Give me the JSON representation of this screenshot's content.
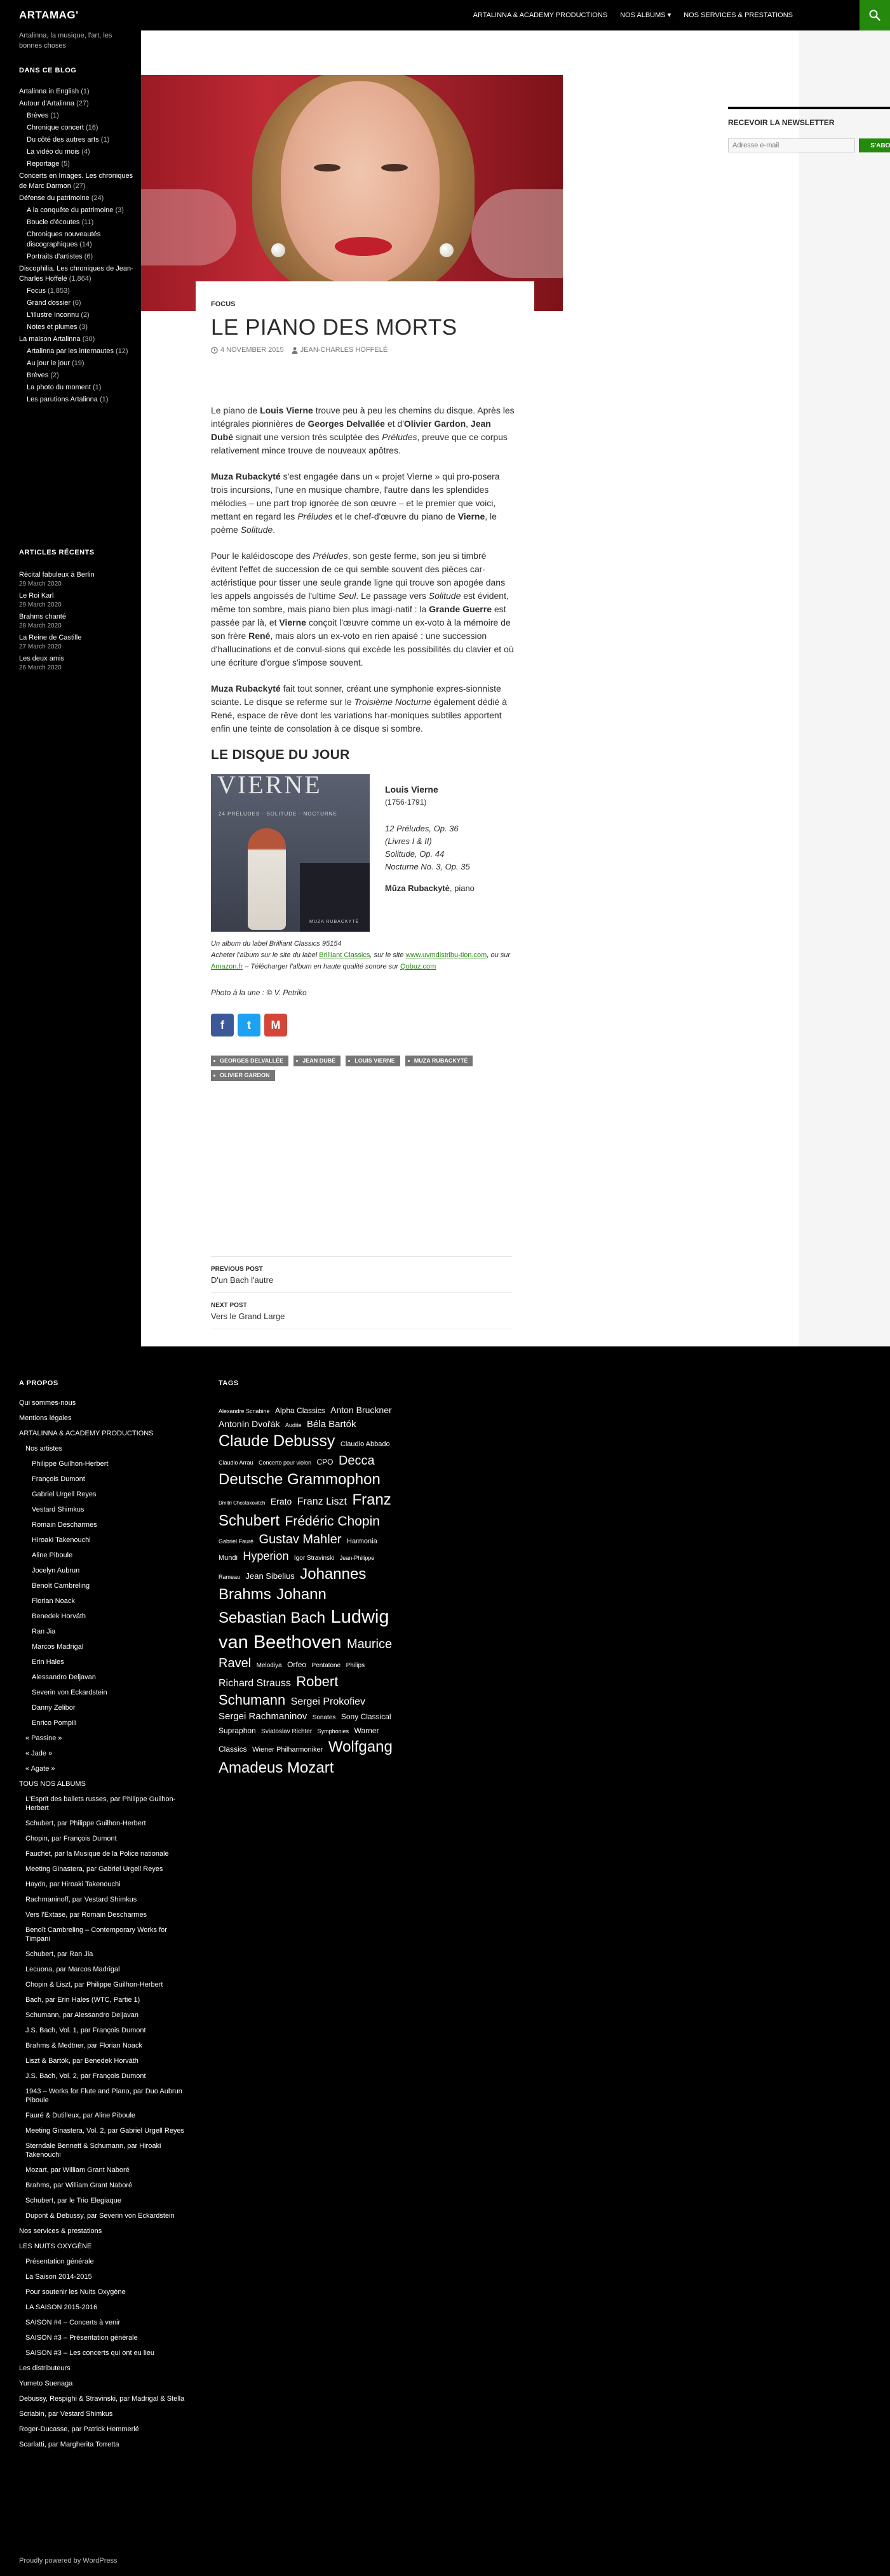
{
  "header": {
    "brand": "ARTAMAG'",
    "nav": [
      "ARTALINNA & ACADEMY PRODUCTIONS",
      "NOS ALBUMS",
      "NOS SERVICES & PRESTATIONS"
    ]
  },
  "left_sidebar": {
    "tagline": "Artalinna, la musique, l'art, les bonnes choses",
    "blog_title": "DANS CE BLOG",
    "categories": [
      {
        "label": "Artalinna in English",
        "count": "(1)",
        "sub": false
      },
      {
        "label": "Autour d'Artalinna",
        "count": "(27)",
        "sub": false
      },
      {
        "label": "Brèves",
        "count": "(1)",
        "sub": true
      },
      {
        "label": "Chronique concert",
        "count": "(16)",
        "sub": true
      },
      {
        "label": "Du côté des autres arts",
        "count": "(1)",
        "sub": true
      },
      {
        "label": "La vidéo du mois",
        "count": "(4)",
        "sub": true
      },
      {
        "label": "Reportage",
        "count": "(5)",
        "sub": true
      },
      {
        "label": "Concerts en Images. Les chroniques de Marc Darmon",
        "count": "(27)",
        "sub": false
      },
      {
        "label": "Défense du patrimoine",
        "count": "(24)",
        "sub": false
      },
      {
        "label": "A la conquête du patrimoine",
        "count": "(3)",
        "sub": true
      },
      {
        "label": "Boucle d'écoutes",
        "count": "(11)",
        "sub": true
      },
      {
        "label": "Chroniques nouveautés discographiques",
        "count": "(14)",
        "sub": true
      },
      {
        "label": "Portraits d'artistes",
        "count": "(6)",
        "sub": true
      },
      {
        "label": "Discophilia. Les chroniques de Jean-Charles Hoffelé",
        "count": "(1,864)",
        "sub": false
      },
      {
        "label": "Focus",
        "count": "(1,853)",
        "sub": true
      },
      {
        "label": "Grand dossier",
        "count": "(6)",
        "sub": true
      },
      {
        "label": "L'illustre Inconnu",
        "count": "(2)",
        "sub": true
      },
      {
        "label": "Notes et plumes",
        "count": "(3)",
        "sub": true
      },
      {
        "label": "La maison Artalinna",
        "count": "(30)",
        "sub": false
      },
      {
        "label": "Artalinna par les internautes",
        "count": "(12)",
        "sub": true
      },
      {
        "label": "Au jour le jour",
        "count": "(19)",
        "sub": true
      },
      {
        "label": "Brèves",
        "count": "(2)",
        "sub": true
      },
      {
        "label": "La photo du moment",
        "count": "(1)",
        "sub": true
      },
      {
        "label": "Les parutions Artalinna",
        "count": "(1)",
        "sub": true
      }
    ],
    "recent_title": "ARTICLES RÉCENTS",
    "recent": [
      {
        "title": "Récital fabuleux à Berlin",
        "date": "29 March 2020"
      },
      {
        "title": "Le Roi Karl",
        "date": "29 March 2020"
      },
      {
        "title": "Brahms chanté",
        "date": "28 March 2020"
      },
      {
        "title": "La Reine de Castille",
        "date": "27 March 2020"
      },
      {
        "title": "Les deux amis",
        "date": "26 March 2020"
      }
    ]
  },
  "article": {
    "category": "FOCUS",
    "title": "LE PIANO DES MORTS",
    "date": "4 NOVEMBER 2015",
    "author": "JEAN-CHARLES HOFFELÉ",
    "paragraphs": [
      [
        {
          "t": "Le piano de "
        },
        {
          "t": "Louis Vierne",
          "b": true
        },
        {
          "t": " trouve peu à peu les chemins du disque. Après les intégrales pionnières de "
        },
        {
          "t": "Georges Delvallée",
          "b": true
        },
        {
          "t": " et d'"
        },
        {
          "t": "Olivier Gardon",
          "b": true
        },
        {
          "t": ", "
        },
        {
          "t": "Jean Dubé",
          "b": true
        },
        {
          "t": " signait une version très sculptée des "
        },
        {
          "t": "Préludes",
          "i": true
        },
        {
          "t": ", preuve que ce corpus relativement mince trouve de nouveaux apôtres."
        }
      ],
      [
        {
          "t": "Muza Rubackyté",
          "b": true
        },
        {
          "t": " s'est engagée dans un « projet Vierne » qui pro-posera trois incursions, l'une en musique chambre, l'autre dans les splendides mélodies – une part trop ignorée de son œuvre – et le premier que voici, mettant en regard les "
        },
        {
          "t": "Préludes",
          "i": true
        },
        {
          "t": " et le chef-d'œuvre du piano de "
        },
        {
          "t": "Vierne",
          "b": true
        },
        {
          "t": ", le poème "
        },
        {
          "t": "Solitude",
          "i": true
        },
        {
          "t": "."
        }
      ],
      [
        {
          "t": "Pour le kaléidoscope des "
        },
        {
          "t": "Préludes",
          "i": true
        },
        {
          "t": ", son geste ferme, son jeu si timbré évitent l'effet de succession de ce qui semble souvent des pièces car-actéristique pour tisser une seule grande ligne qui trouve son apogée dans les appels angoissés de l'ultime "
        },
        {
          "t": "Seul",
          "i": true
        },
        {
          "t": ". Le passage vers "
        },
        {
          "t": "Solitude",
          "i": true
        },
        {
          "t": " est évident, même ton sombre, mais piano bien plus imagi-natif : la "
        },
        {
          "t": "Grande Guerre",
          "b": true
        },
        {
          "t": " est passée par là, et "
        },
        {
          "t": "Vierne",
          "b": true
        },
        {
          "t": " conçoit l'œuvre comme un ex-voto à la mémoire de son frère "
        },
        {
          "t": "René",
          "b": true
        },
        {
          "t": ", mais alors un ex-voto en rien apaisé : une succession d'hallucinations et de convul-sions qui excède les possibilités du clavier et où une écriture d'orgue s'impose souvent."
        }
      ],
      [
        {
          "t": "Muza Rubackyté",
          "b": true
        },
        {
          "t": " fait tout sonner, créant une symphonie expres-sionniste sciante. Le disque se referme sur le "
        },
        {
          "t": "Troisième Nocturne",
          "i": true
        },
        {
          "t": " également dédié à René, espace de rêve dont les variations har-moniques subtiles apportent enfin une teinte de consolation à ce disque si sombre."
        }
      ]
    ],
    "disc_heading": "LE DISQUE DU JOUR",
    "cover": {
      "title": "VIERNE",
      "subtitle": "24 PRÉLUDES · SOLITUDE · NOCTURNE",
      "label": "MUZA RUBACKYTÉ"
    },
    "composer": "Louis Vierne",
    "composer_dates": "(1756-1791)",
    "works": [
      "12 Préludes, Op. 36",
      "(Livres I & II)",
      "Solitude, Op. 44",
      "Nocturne No. 3, Op. 35"
    ],
    "performer": "Mūza Rubackytė",
    "performer_role": ", piano",
    "caption_line1": "Un album du label Brilliant Classics 95154",
    "caption_a": "Acheter l'album sur le site du label ",
    "link_brilliant": "Brilliant Classics",
    "caption_b": ", sur le site ",
    "link_uvm": "www.uvmdistribu-tion.com",
    "caption_c": ", ou sur ",
    "link_amazon": "Amazon.fr",
    "caption_d": " – Télécharger l'album en haute qualité sonore sur ",
    "link_qobuz": "Qobuz.com",
    "photo_credit": "Photo à la une : © V. Petriko",
    "share": [
      {
        "name": "facebook",
        "glyph": "f",
        "color": "#3b5998"
      },
      {
        "name": "twitter",
        "glyph": "t",
        "color": "#1da1f2"
      },
      {
        "name": "gmail",
        "glyph": "M",
        "color": "#d44638"
      }
    ],
    "tags": [
      "GEORGES DELVALLÉE",
      "JEAN DUBÉ",
      "LOUIS VIERNE",
      "MUZA RUBACKYTÉ",
      "OLIVIER GARDON"
    ],
    "prev_label": "PREVIOUS POST",
    "prev_title": "D'un Bach l'autre",
    "next_label": "NEXT POST",
    "next_title": "Vers le Grand Large"
  },
  "right_sidebar": {
    "newsletter_title": "RECEVOIR LA NEWSLETTER",
    "email_placeholder": "Adresse e-mail",
    "subscribe": "S'ABONNER"
  },
  "footer": {
    "about_title": "A PROPOS",
    "about_items": [
      {
        "t": "Qui sommes-nous",
        "d": 0
      },
      {
        "t": "Mentions légales",
        "d": 0
      },
      {
        "t": "ARTALINNA & ACADEMY PRODUCTIONS",
        "d": 0
      },
      {
        "t": "Nos artistes",
        "d": 1
      },
      {
        "t": "Philippe Guilhon-Herbert",
        "d": 2
      },
      {
        "t": "François Dumont",
        "d": 2
      },
      {
        "t": "Gabriel Urgell Reyes",
        "d": 2
      },
      {
        "t": "Vestard Shimkus",
        "d": 2
      },
      {
        "t": "Romain Descharmes",
        "d": 2
      },
      {
        "t": "Hiroaki Takenouchi",
        "d": 2
      },
      {
        "t": "Aline Piboule",
        "d": 2
      },
      {
        "t": "Jocelyn Aubrun",
        "d": 2
      },
      {
        "t": "Benoît Cambreling",
        "d": 2
      },
      {
        "t": "Florian Noack",
        "d": 2
      },
      {
        "t": "Benedek Horváth",
        "d": 2
      },
      {
        "t": "Ran Jia",
        "d": 2
      },
      {
        "t": "Marcos Madrigal",
        "d": 2
      },
      {
        "t": "Erin Hales",
        "d": 2
      },
      {
        "t": "Alessandro Deljavan",
        "d": 2
      },
      {
        "t": "Severin von Eckardstein",
        "d": 2
      },
      {
        "t": "Danny Zelibor",
        "d": 2
      },
      {
        "t": "Enrico Pompili",
        "d": 2
      },
      {
        "t": "« Passine »",
        "d": 1
      },
      {
        "t": "« Jade »",
        "d": 1
      },
      {
        "t": "« Agate »",
        "d": 1
      },
      {
        "t": "TOUS NOS ALBUMS",
        "d": 0
      },
      {
        "t": "L'Esprit des ballets russes, par Philippe Guilhon-Herbert",
        "d": 1
      },
      {
        "t": "Schubert, par Philippe Guilhon-Herbert",
        "d": 1
      },
      {
        "t": "Chopin, par François Dumont",
        "d": 1
      },
      {
        "t": "Fauchet, par la Musique de la Police nationale",
        "d": 1
      },
      {
        "t": "Meeting Ginastera, par Gabriel Urgell Reyes",
        "d": 1
      },
      {
        "t": "Haydn, par Hiroaki Takenouchi",
        "d": 1
      },
      {
        "t": "Rachmaninoff, par Vestard Shimkus",
        "d": 1
      },
      {
        "t": "Vers l'Extase, par Romain Descharmes",
        "d": 1
      },
      {
        "t": "Benoît Cambreling – Contemporary Works for Timpani",
        "d": 1
      },
      {
        "t": "Schubert, par Ran Jia",
        "d": 1
      },
      {
        "t": "Lecuona, par Marcos Madrigal",
        "d": 1
      },
      {
        "t": "Chopin & Liszt, par Philippe Guilhon-Herbert",
        "d": 1
      },
      {
        "t": "Bach, par Erin Hales (WTC, Partie 1)",
        "d": 1
      },
      {
        "t": "Schumann, par Alessandro Deljavan",
        "d": 1
      },
      {
        "t": "J.S. Bach, Vol. 1, par François Dumont",
        "d": 1
      },
      {
        "t": "Brahms & Medtner, par Florian Noack",
        "d": 1
      },
      {
        "t": "Liszt & Bartók, par Benedek Horváth",
        "d": 1
      },
      {
        "t": "J.S. Bach, Vol. 2, par François Dumont",
        "d": 1
      },
      {
        "t": "1943 – Works for Flute and Piano, par Duo Aubrun Piboule",
        "d": 1
      },
      {
        "t": "Fauré & Dutilleux, par Aline Piboule",
        "d": 1
      },
      {
        "t": "Meeting Ginastera, Vol. 2, par Gabriel Urgell Reyes",
        "d": 1
      },
      {
        "t": "Sterndale Bennett & Schumann, par Hiroaki Takenouchi",
        "d": 1
      },
      {
        "t": "Mozart, par William Grant Naboré",
        "d": 1
      },
      {
        "t": "Brahms, par William Grant Naboré",
        "d": 1
      },
      {
        "t": "Schubert, par le Trio Elegiaque",
        "d": 1
      },
      {
        "t": "Dupont & Debussy, par Severin von Eckardstein",
        "d": 1
      },
      {
        "t": "Nos services & prestations",
        "d": 0
      },
      {
        "t": "LES NUITS OXYGÈNE",
        "d": 0
      },
      {
        "t": "Présentation générale",
        "d": 1
      },
      {
        "t": "La Saison 2014-2015",
        "d": 1
      },
      {
        "t": "Pour soutenir les Nuits Oxygène",
        "d": 1
      },
      {
        "t": "LA SAISON 2015-2016",
        "d": 1
      },
      {
        "t": "SAISON #4 – Concerts à venir",
        "d": 1
      },
      {
        "t": "SAISON #3 – Présentation générale",
        "d": 1
      },
      {
        "t": "SAISON #3 – Les concerts qui ont eu lieu",
        "d": 1
      },
      {
        "t": "Les distributeurs",
        "d": 0
      },
      {
        "t": "Yumeto Suenaga",
        "d": 0
      },
      {
        "t": "Debussy, Respighi & Stravinski, par Madrigal & Stella",
        "d": 0
      },
      {
        "t": "Scriabin, par Vestard Shimkus",
        "d": 0
      },
      {
        "t": "Roger-Ducasse, par Patrick Hemmerlé",
        "d": 0
      },
      {
        "t": "Scarlatti, par Margherita Torretta",
        "d": 0
      }
    ],
    "tags_title": "TAGS",
    "tagcloud": [
      {
        "t": "Alexandre Scriabine",
        "s": 9
      },
      {
        "t": "Alpha Classics",
        "s": 12
      },
      {
        "t": "Anton Bruckner",
        "s": 14
      },
      {
        "t": "Antonín Dvořák",
        "s": 14
      },
      {
        "t": "Audite",
        "s": 9
      },
      {
        "t": "Béla Bartók",
        "s": 15
      },
      {
        "t": "Claude Debussy",
        "s": 25
      },
      {
        "t": "Claudio Abbado",
        "s": 11
      },
      {
        "t": "Claudio Arrau",
        "s": 9
      },
      {
        "t": "Concerto pour violon",
        "s": 9
      },
      {
        "t": "CPO",
        "s": 12
      },
      {
        "t": "Decca",
        "s": 20
      },
      {
        "t": "Deutsche Grammophon",
        "s": 24
      },
      {
        "t": "Dmitri Chostakovitch",
        "s": 8
      },
      {
        "t": "Erato",
        "s": 14
      },
      {
        "t": "Franz Liszt",
        "s": 16
      },
      {
        "t": "Franz Schubert",
        "s": 24
      },
      {
        "t": "Frédéric Chopin",
        "s": 21
      },
      {
        "t": "Gabriel Fauré",
        "s": 9
      },
      {
        "t": "Gustav Mahler",
        "s": 20
      },
      {
        "t": "Harmonia Mundi",
        "s": 11
      },
      {
        "t": "Hyperion",
        "s": 18
      },
      {
        "t": "Igor Stravinski",
        "s": 10
      },
      {
        "t": "Jean-Philippe Rameau",
        "s": 9
      },
      {
        "t": "Jean Sibelius",
        "s": 13
      },
      {
        "t": "Johannes Brahms",
        "s": 24
      },
      {
        "t": "Johann Sebastian Bach",
        "s": 24
      },
      {
        "t": "Ludwig van Beethoven",
        "s": 29
      },
      {
        "t": "Maurice Ravel",
        "s": 20
      },
      {
        "t": "Melodiya",
        "s": 10
      },
      {
        "t": "Orfeo",
        "s": 12
      },
      {
        "t": "Pentatone",
        "s": 10
      },
      {
        "t": "Philips",
        "s": 10
      },
      {
        "t": "Richard Strauss",
        "s": 16
      },
      {
        "t": "Robert Schumann",
        "s": 22
      },
      {
        "t": "Sergei Prokofiev",
        "s": 16
      },
      {
        "t": "Sergei Rachmaninov",
        "s": 15
      },
      {
        "t": "Sonates",
        "s": 10
      },
      {
        "t": "Sony Classical",
        "s": 12
      },
      {
        "t": "Supraphon",
        "s": 12
      },
      {
        "t": "Sviatoslav Richter",
        "s": 10
      },
      {
        "t": "Symphonies",
        "s": 9
      },
      {
        "t": "Warner Classics",
        "s": 12
      },
      {
        "t": "Wiener Philharmoniker",
        "s": 11
      },
      {
        "t": "Wolfgang Amadeus Mozart",
        "s": 24
      }
    ],
    "credit": "Proudly powered by WordPress"
  }
}
